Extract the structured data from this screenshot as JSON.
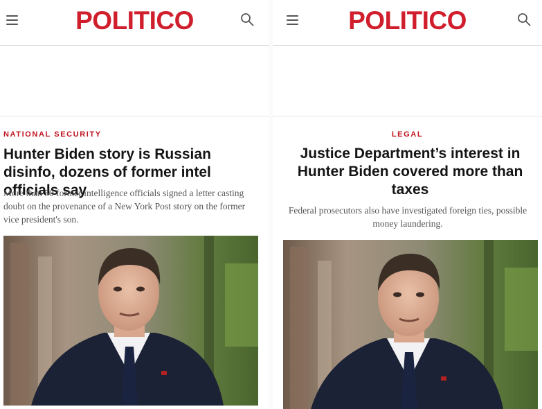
{
  "panels": [
    {
      "brand": "POLITICO",
      "kicker": "NATIONAL SECURITY",
      "headline": "Hunter Biden story is Russian disinfo, dozens of former intel officials say",
      "dek": "More than 50 former intelligence officials signed a letter casting doubt on the provenance of a New York Post story on the former vice president's son.",
      "icons": {
        "menu": "hamburger-menu-icon",
        "search": "search-icon"
      }
    },
    {
      "brand": "POLITICO",
      "kicker": "LEGAL",
      "headline": "Justice Department’s interest in Hunter Biden covered more than taxes",
      "dek": "Federal prosecutors also have investigated foreign ties, possible money laundering.",
      "icons": {
        "menu": "hamburger-menu-icon",
        "search": "search-icon"
      }
    }
  ],
  "colors": {
    "brand_red": "#d01e2d",
    "kicker_red": "#c0141e",
    "headline": "#141414",
    "dek": "#555555"
  }
}
